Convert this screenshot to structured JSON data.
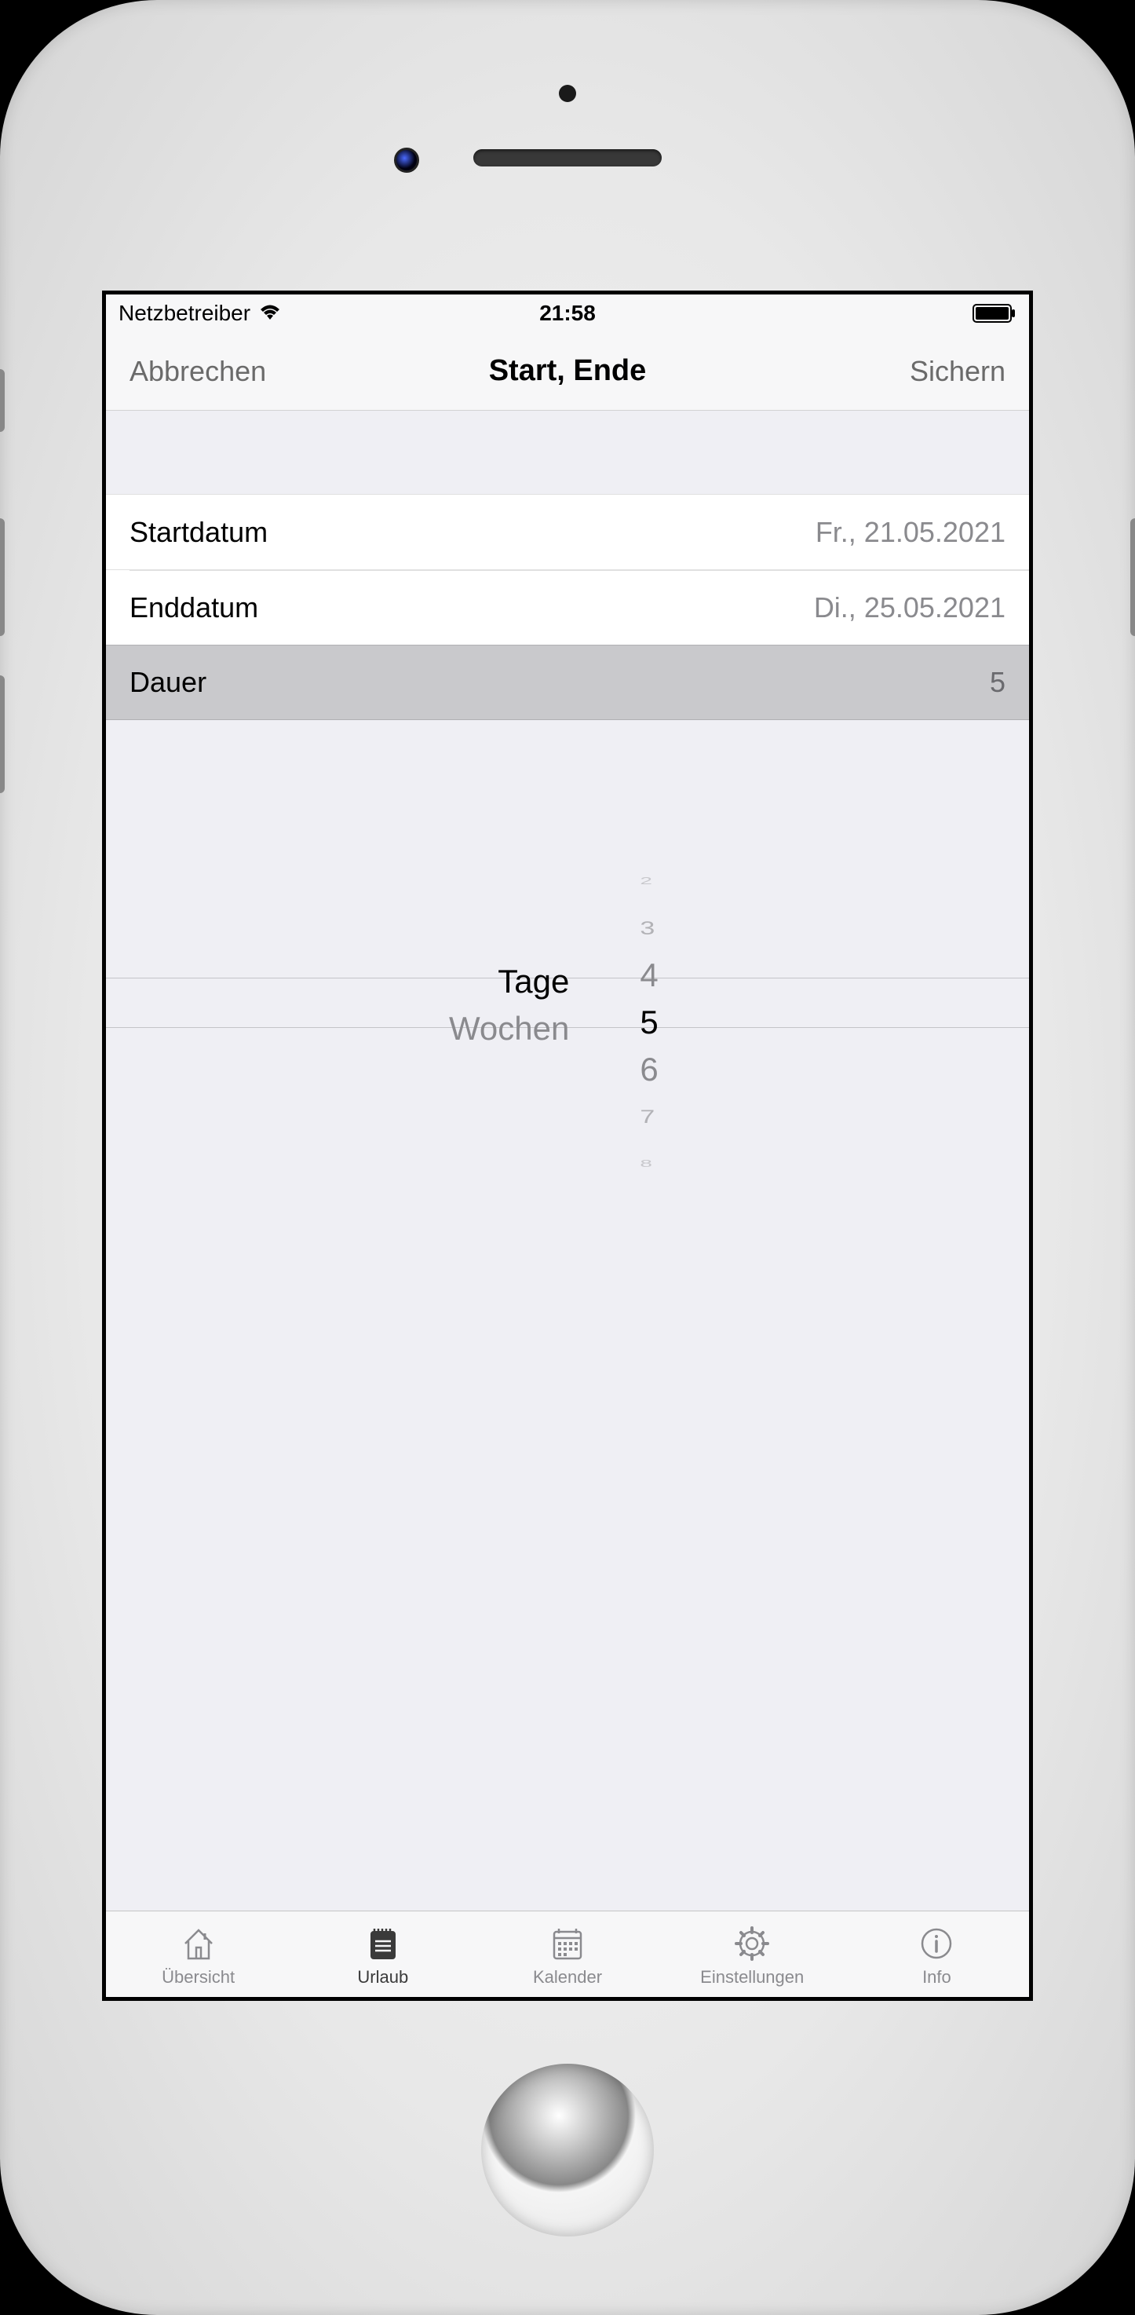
{
  "status": {
    "carrier": "Netzbetreiber",
    "time": "21:58"
  },
  "nav": {
    "cancel": "Abbrechen",
    "title": "Start, Ende",
    "save": "Sichern"
  },
  "rows": {
    "start_label": "Startdatum",
    "start_value": "Fr., 21.05.2021",
    "end_label": "Enddatum",
    "end_value": "Di., 25.05.2021",
    "duration_label": "Dauer",
    "duration_value": "5"
  },
  "picker": {
    "units": [
      "Tage",
      "Wochen"
    ],
    "unit_selected": "Tage",
    "numbers": [
      "2",
      "3",
      "4",
      "5",
      "6",
      "7",
      "8"
    ],
    "number_selected": "5"
  },
  "tabs": {
    "overview": "Übersicht",
    "vacation": "Urlaub",
    "calendar": "Kalender",
    "settings": "Einstellungen",
    "info": "Info"
  }
}
